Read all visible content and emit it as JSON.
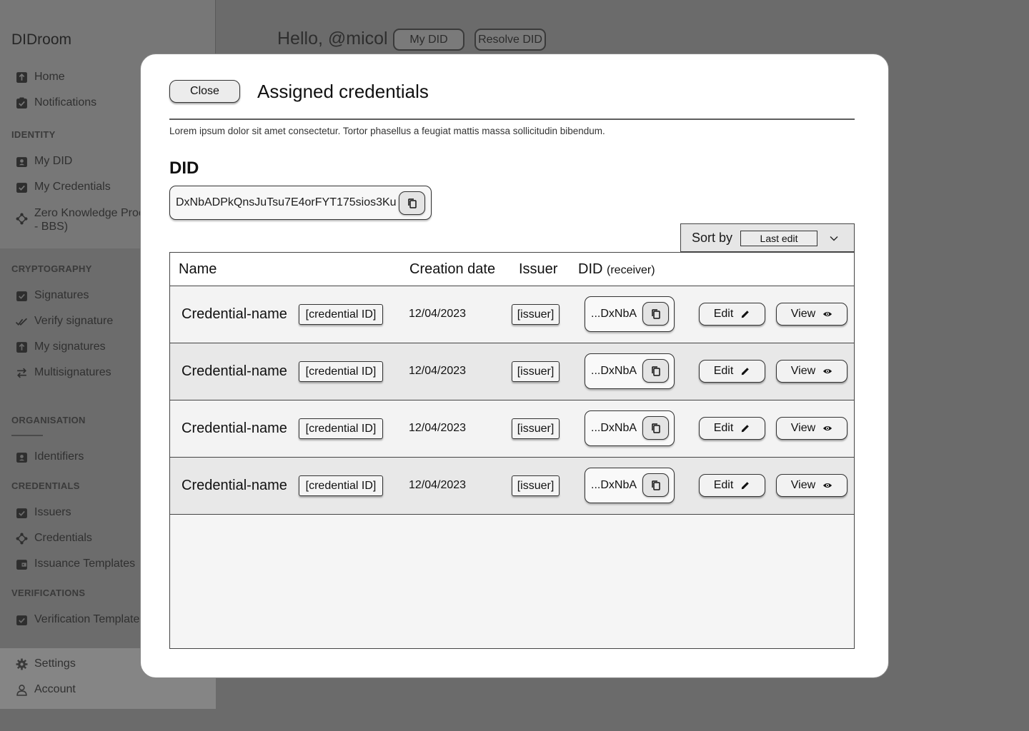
{
  "app": {
    "brand": "DIDroom",
    "greeting": "Hello, @micol",
    "header_buttons": [
      "My DID",
      "Resolve DID"
    ]
  },
  "sidebar": {
    "top_items": [
      {
        "label": "Home",
        "icon": "home-icon"
      },
      {
        "label": "Notifications",
        "icon": "notifications-icon"
      }
    ],
    "sections": [
      {
        "title": "IDENTITY",
        "items": [
          {
            "label": "My DID",
            "icon": "badge-icon"
          },
          {
            "label": "My Credentials",
            "icon": "checklist-icon"
          },
          {
            "label": "Zero Knowledge Proc",
            "label_line2": "- BBS)",
            "icon": "graph-icon"
          }
        ]
      },
      {
        "title": "CRYPTOGRAPHY",
        "items": [
          {
            "label": "Signatures",
            "icon": "checklist-icon"
          },
          {
            "label": "Verify signature",
            "icon": "double-check-icon"
          },
          {
            "label": "My signatures",
            "icon": "upload-icon"
          },
          {
            "label": "Multisignatures",
            "icon": "transfer-icon"
          }
        ]
      },
      {
        "title": "ORGANISATION",
        "items": [
          {
            "label": "Identifiers",
            "icon": "badge-icon"
          }
        ]
      },
      {
        "title": "CREDENTIALS",
        "items": [
          {
            "label": "Issuers",
            "icon": "checklist-icon"
          },
          {
            "label": "Credentials",
            "icon": "graph-icon"
          },
          {
            "label": "Issuance Templates",
            "icon": "wallet-icon"
          }
        ]
      },
      {
        "title": "VERIFICATIONS",
        "items": [
          {
            "label": "Verification Template",
            "icon": "checklist-icon"
          }
        ]
      }
    ],
    "bottom_items": [
      {
        "label": "Settings",
        "icon": "gear-icon"
      },
      {
        "label": "Account",
        "icon": "user-icon"
      }
    ]
  },
  "modal": {
    "close_label": "Close",
    "title": "Assigned credentials",
    "description": "Lorem ipsum dolor sit amet consectetur. Tortor phasellus a feugiat mattis massa sollicitudin bibendum.",
    "did_heading": "DID",
    "did_value": "DxNbADPkQnsJuTsu7E4orFYT175sios3Ku",
    "sort": {
      "label": "Sort by",
      "selected": "Last edit"
    },
    "table": {
      "headers": {
        "name": "Name",
        "creation_date": "Creation date",
        "issuer": "Issuer",
        "did": "DID",
        "did_suffix": "(receiver)"
      },
      "rows": [
        {
          "name": "Credential-name",
          "id": "[credential ID]",
          "date": "12/04/2023",
          "issuer": "[issuer]",
          "did": "...DxNbA",
          "edit": "Edit",
          "view": "View"
        },
        {
          "name": "Credential-name",
          "id": "[credential ID]",
          "date": "12/04/2023",
          "issuer": "[issuer]",
          "did": "...DxNbA",
          "edit": "Edit",
          "view": "View"
        },
        {
          "name": "Credential-name",
          "id": "[credential ID]",
          "date": "12/04/2023",
          "issuer": "[issuer]",
          "did": "...DxNbA",
          "edit": "Edit",
          "view": "View"
        },
        {
          "name": "Credential-name",
          "id": "[credential ID]",
          "date": "12/04/2023",
          "issuer": "[issuer]",
          "did": "...DxNbA",
          "edit": "Edit",
          "view": "View"
        }
      ]
    }
  }
}
